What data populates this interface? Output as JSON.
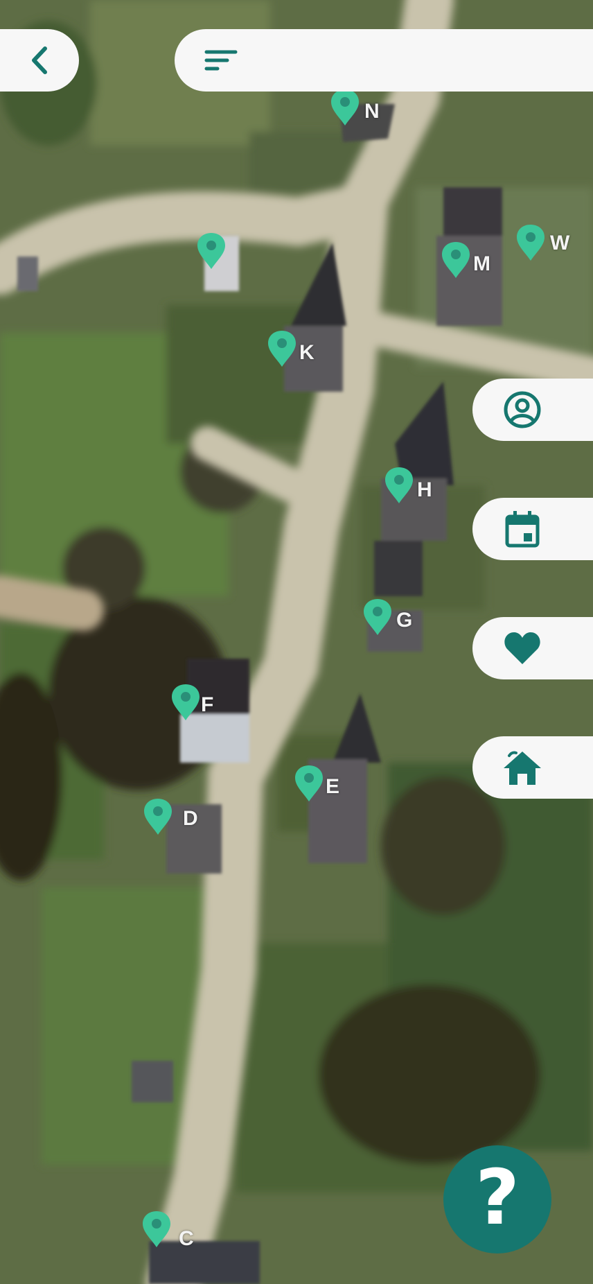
{
  "header": {
    "search_placeholder": ""
  },
  "side_buttons": [
    {
      "icon": "account-circle-icon"
    },
    {
      "icon": "calendar-icon"
    },
    {
      "icon": "heart-icon"
    },
    {
      "icon": "home-icon"
    }
  ],
  "help": {
    "label": "?"
  },
  "markers": [
    {
      "label": "N"
    },
    {
      "label": "W"
    },
    {
      "label": "M"
    },
    {
      "label": ""
    },
    {
      "label": "K"
    },
    {
      "label": "H"
    },
    {
      "label": "G"
    },
    {
      "label": "F"
    },
    {
      "label": "E"
    },
    {
      "label": "D"
    },
    {
      "label": "C"
    }
  ],
  "colors": {
    "accent": "#16776f",
    "marker": "#3cc79a",
    "button_bg": "#f7f7f7"
  }
}
